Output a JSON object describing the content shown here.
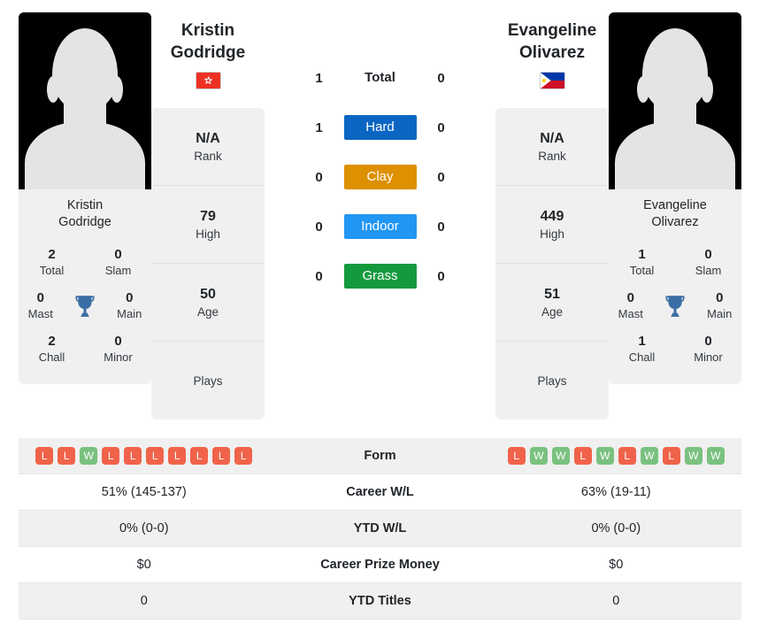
{
  "colors": {
    "hard": "#0a66c2",
    "clay": "#dd9000",
    "indoor": "#2196f3",
    "grass": "#149a3e",
    "win": "#7ac17f",
    "loss": "#f0634a",
    "trophy": "#3b6ea5",
    "panel": "#f0f0f0"
  },
  "left_player": {
    "name": "Kristin Godridge",
    "name_line1": "Kristin",
    "name_line2": "Godridge",
    "photo_caption_line1": "Kristin",
    "photo_caption_line2": "Godridge",
    "country": "Hong Kong",
    "flag": "hong-kong-flag",
    "titles": [
      {
        "value": "2",
        "label": "Total"
      },
      {
        "value": "0",
        "label": "Slam"
      },
      {
        "value": "0",
        "label": "Mast"
      },
      {
        "value": "0",
        "label": "Main"
      },
      {
        "value": "2",
        "label": "Chall"
      },
      {
        "value": "0",
        "label": "Minor"
      }
    ],
    "info": [
      {
        "value": "N/A",
        "label": "Rank"
      },
      {
        "value": "79",
        "label": "High"
      },
      {
        "value": "50",
        "label": "Age"
      },
      {
        "value": "",
        "label": "Plays"
      }
    ],
    "form": [
      "L",
      "L",
      "W",
      "L",
      "L",
      "L",
      "L",
      "L",
      "L",
      "L"
    ],
    "career_wl": "51% (145-137)",
    "ytd_wl": "0% (0-0)",
    "career_prize_money": "$0",
    "ytd_titles": "0"
  },
  "right_player": {
    "name": "Evangeline Olivarez",
    "name_line1": "Evangeline",
    "name_line2": "Olivarez",
    "photo_caption_line1": "Evangeline",
    "photo_caption_line2": "Olivarez",
    "country": "Philippines",
    "flag": "philippines-flag",
    "titles": [
      {
        "value": "1",
        "label": "Total"
      },
      {
        "value": "0",
        "label": "Slam"
      },
      {
        "value": "0",
        "label": "Mast"
      },
      {
        "value": "0",
        "label": "Main"
      },
      {
        "value": "1",
        "label": "Chall"
      },
      {
        "value": "0",
        "label": "Minor"
      }
    ],
    "info": [
      {
        "value": "N/A",
        "label": "Rank"
      },
      {
        "value": "449",
        "label": "High"
      },
      {
        "value": "51",
        "label": "Age"
      },
      {
        "value": "",
        "label": "Plays"
      }
    ],
    "form": [
      "L",
      "W",
      "W",
      "L",
      "W",
      "L",
      "W",
      "L",
      "W",
      "W"
    ],
    "career_wl": "63% (19-11)",
    "ytd_wl": "0% (0-0)",
    "career_prize_money": "$0",
    "ytd_titles": "0"
  },
  "surfaces": [
    {
      "label": "Total",
      "style": "plain",
      "left": "1",
      "right": "0"
    },
    {
      "label": "Hard",
      "style": "hard",
      "left": "1",
      "right": "0"
    },
    {
      "label": "Clay",
      "style": "clay",
      "left": "0",
      "right": "0"
    },
    {
      "label": "Indoor",
      "style": "indoor",
      "left": "0",
      "right": "0"
    },
    {
      "label": "Grass",
      "style": "grass",
      "left": "0",
      "right": "0"
    }
  ],
  "table_rows": [
    {
      "label": "Form"
    },
    {
      "label": "Career W/L"
    },
    {
      "label": "YTD W/L"
    },
    {
      "label": "Career Prize Money"
    },
    {
      "label": "YTD Titles"
    }
  ]
}
